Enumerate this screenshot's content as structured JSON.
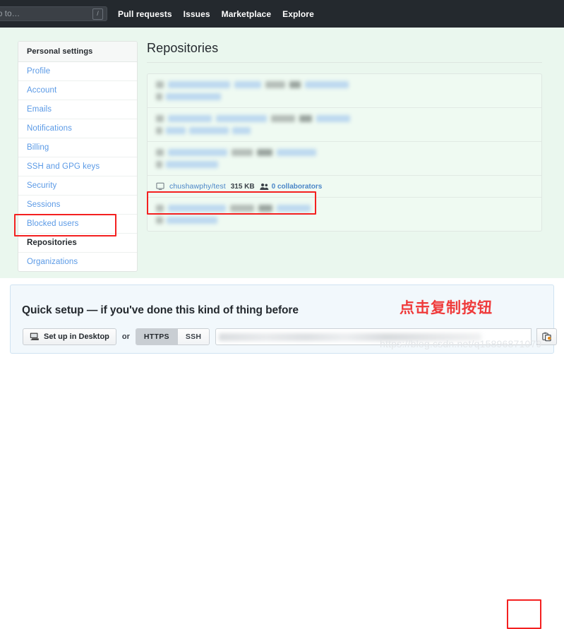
{
  "header": {
    "search": {
      "placeholder": "o to…",
      "shortcut": "/"
    },
    "nav": [
      {
        "label": "Pull requests"
      },
      {
        "label": "Issues"
      },
      {
        "label": "Marketplace"
      },
      {
        "label": "Explore"
      }
    ]
  },
  "sidebar": {
    "heading": "Personal settings",
    "items": [
      {
        "label": "Profile",
        "selected": false
      },
      {
        "label": "Account",
        "selected": false
      },
      {
        "label": "Emails",
        "selected": false
      },
      {
        "label": "Notifications",
        "selected": false
      },
      {
        "label": "Billing",
        "selected": false
      },
      {
        "label": "SSH and GPG keys",
        "selected": false
      },
      {
        "label": "Security",
        "selected": false
      },
      {
        "label": "Sessions",
        "selected": false
      },
      {
        "label": "Blocked users",
        "selected": false
      },
      {
        "label": "Repositories",
        "selected": true
      },
      {
        "label": "Organizations",
        "selected": false
      }
    ]
  },
  "main": {
    "title": "Repositories",
    "repo_rows": [
      {
        "redacted": true
      },
      {
        "redacted": true
      },
      {
        "redacted": true
      },
      {
        "redacted": false,
        "name": "chushawphy/test",
        "size": "315 KB",
        "collaborators": "0 collaborators",
        "repo_icon": "repo-icon",
        "people_icon": "people-icon"
      },
      {
        "redacted": true
      }
    ]
  },
  "quick_setup": {
    "title": "Quick setup — if you've done this kind of thing before",
    "desktop_button": "Set up in Desktop",
    "desktop_icon": "desktop-icon",
    "or_label": "or",
    "protocols": [
      {
        "label": "HTTPS",
        "active": true
      },
      {
        "label": "SSH",
        "active": false
      }
    ],
    "clone_url_value": "",
    "copy_icon": "copy-clipboard-icon"
  },
  "annotations": {
    "note_text": "点击复制按钮",
    "note_color": "#ef3b3b",
    "box_color": "#f42020",
    "watermark": "https://blog.csdn.net/q15896871079"
  },
  "colors": {
    "header_bg": "#24292e",
    "page_bg": "#eaf7ee",
    "panel_bg": "#f2f8fc",
    "link": "#4a86c8"
  }
}
